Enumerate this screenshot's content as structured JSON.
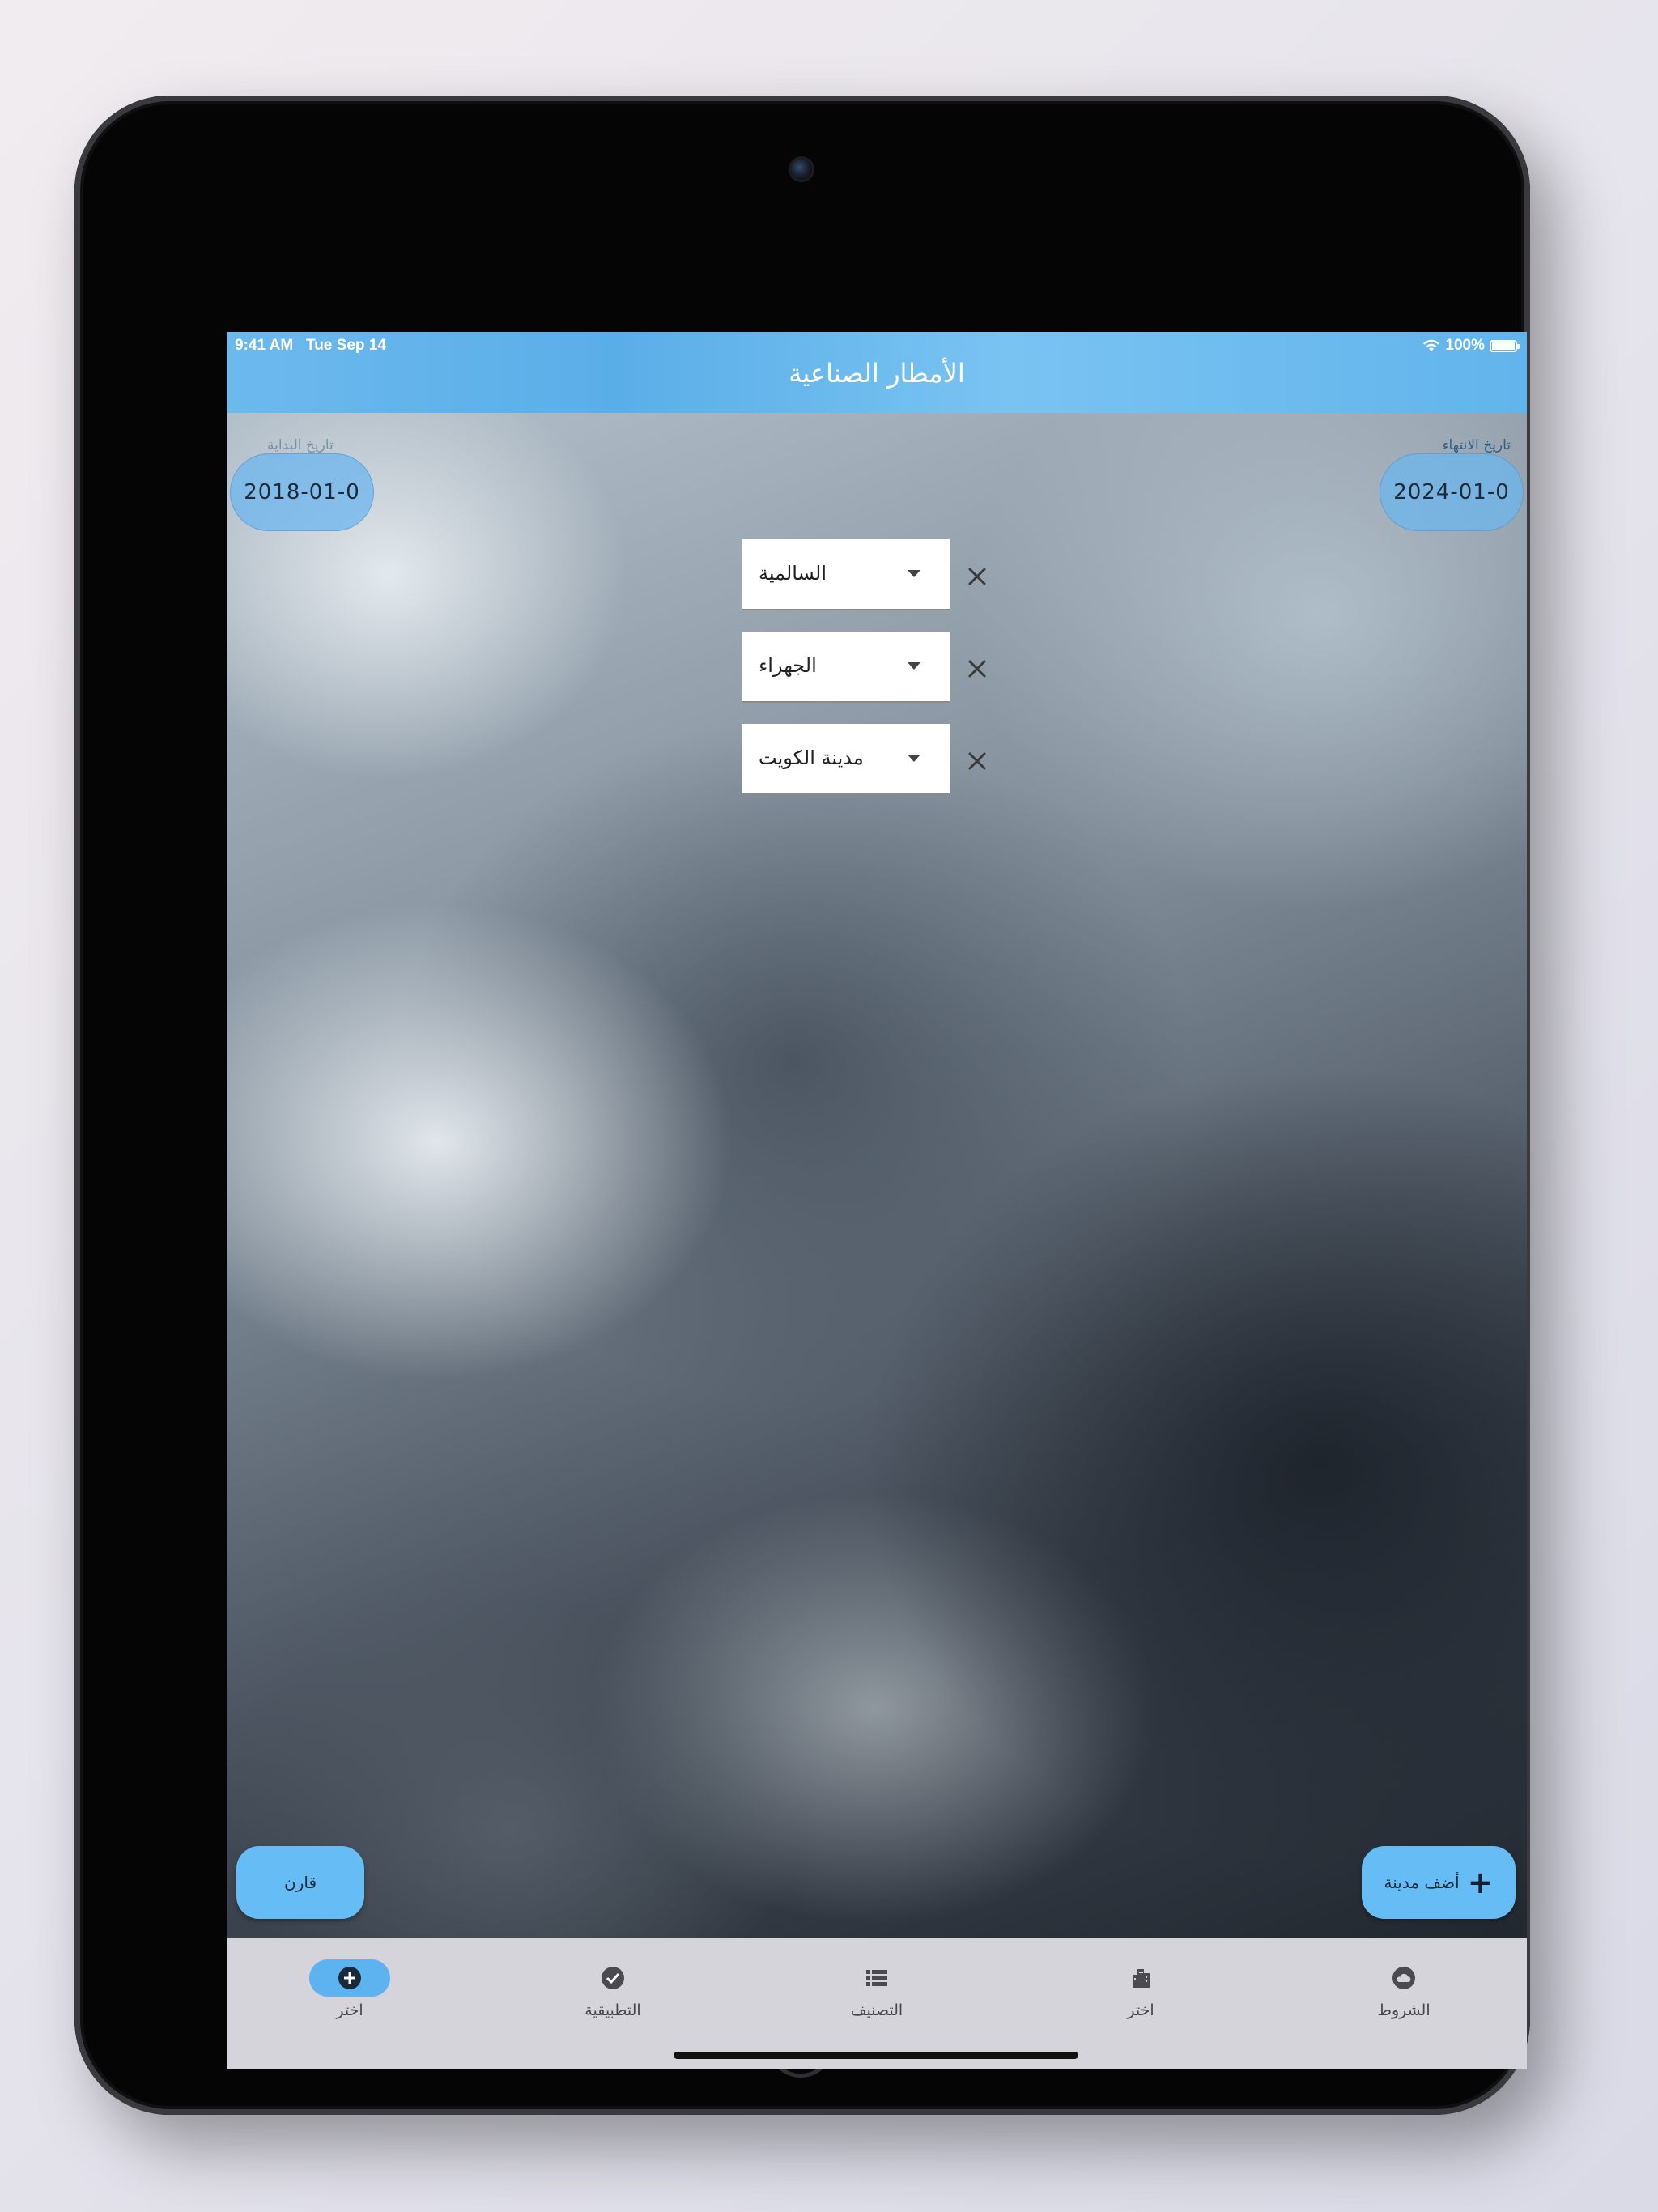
{
  "status_bar": {
    "time": "9:41 AM",
    "date": "Tue Sep 14",
    "battery": "100%"
  },
  "app_bar": {
    "title": "الأمطار الصناعية"
  },
  "start_date": {
    "label": "تاريخ البداية",
    "value": "2018-01-0"
  },
  "end_date": {
    "label": "تاريخ الانتهاء",
    "value": "2024-01-0"
  },
  "cities": [
    {
      "value": "السالمية"
    },
    {
      "value": "الجهراء"
    },
    {
      "value": "مدينة الكويت"
    }
  ],
  "buttons": {
    "compare": "قارن",
    "add_city": "أضف مدينة"
  },
  "bottom_nav": [
    {
      "label": "اختر",
      "icon": "plus-circle-icon",
      "active": true
    },
    {
      "label": "التطبيقية",
      "icon": "check-circle-icon",
      "active": false
    },
    {
      "label": "التصنيف",
      "icon": "list-icon",
      "active": false
    },
    {
      "label": "اختر",
      "icon": "city-icon",
      "active": false
    },
    {
      "label": "الشروط",
      "icon": "cloud-circle-icon",
      "active": false
    }
  ],
  "colors": {
    "accent": "#66bcf5",
    "app_bar": "#6cb9ee",
    "nav_bg": "#d5d4da"
  }
}
